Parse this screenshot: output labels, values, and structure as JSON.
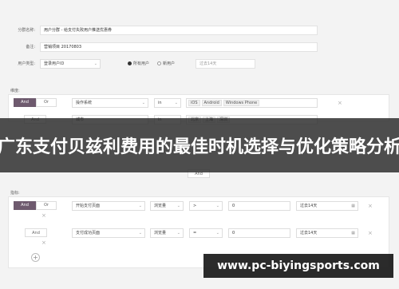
{
  "form": {
    "group_name_label": "分群名称:",
    "group_name_value": "用户分群 - 给支付失败用户推送优惠券",
    "note_label": "备注:",
    "note_value": "营销项目 20170803",
    "user_type_label": "用户类型:",
    "user_type_value": "登录用户ID",
    "radio_all": "所有用户",
    "radio_new": "新用户",
    "date_value": "过去14天"
  },
  "dimension": {
    "title": "维度:",
    "and_label": "And",
    "or_label": "Or",
    "row1": {
      "field": "操作系统",
      "op": "in",
      "tags": [
        "iOS",
        "Android",
        "Windows Phone"
      ]
    },
    "row2": {
      "and_label": "And",
      "field": "城市",
      "op": "in",
      "tags": [
        "北京",
        "上海",
        "深圳"
      ]
    }
  },
  "between": {
    "and_label": "And"
  },
  "metrics": {
    "title": "指标:",
    "and_label": "And",
    "or_label": "Or",
    "row1": {
      "event": "开始支付页面",
      "measure": "浏览量",
      "op": ">",
      "value": "0",
      "range": "过去14天"
    },
    "row2": {
      "and_label": "And",
      "event": "支付成功页面",
      "measure": "浏览量",
      "op": "=",
      "value": "0",
      "range": "过去14天"
    }
  },
  "overlay": {
    "banner": "广东支付贝兹利费用的最佳时机选择与优化策略分析",
    "watermark": "www.pc-biyingsports.com"
  },
  "colors": {
    "accent": "#6e5a6e",
    "banner_bg": "#2a2a2a"
  }
}
